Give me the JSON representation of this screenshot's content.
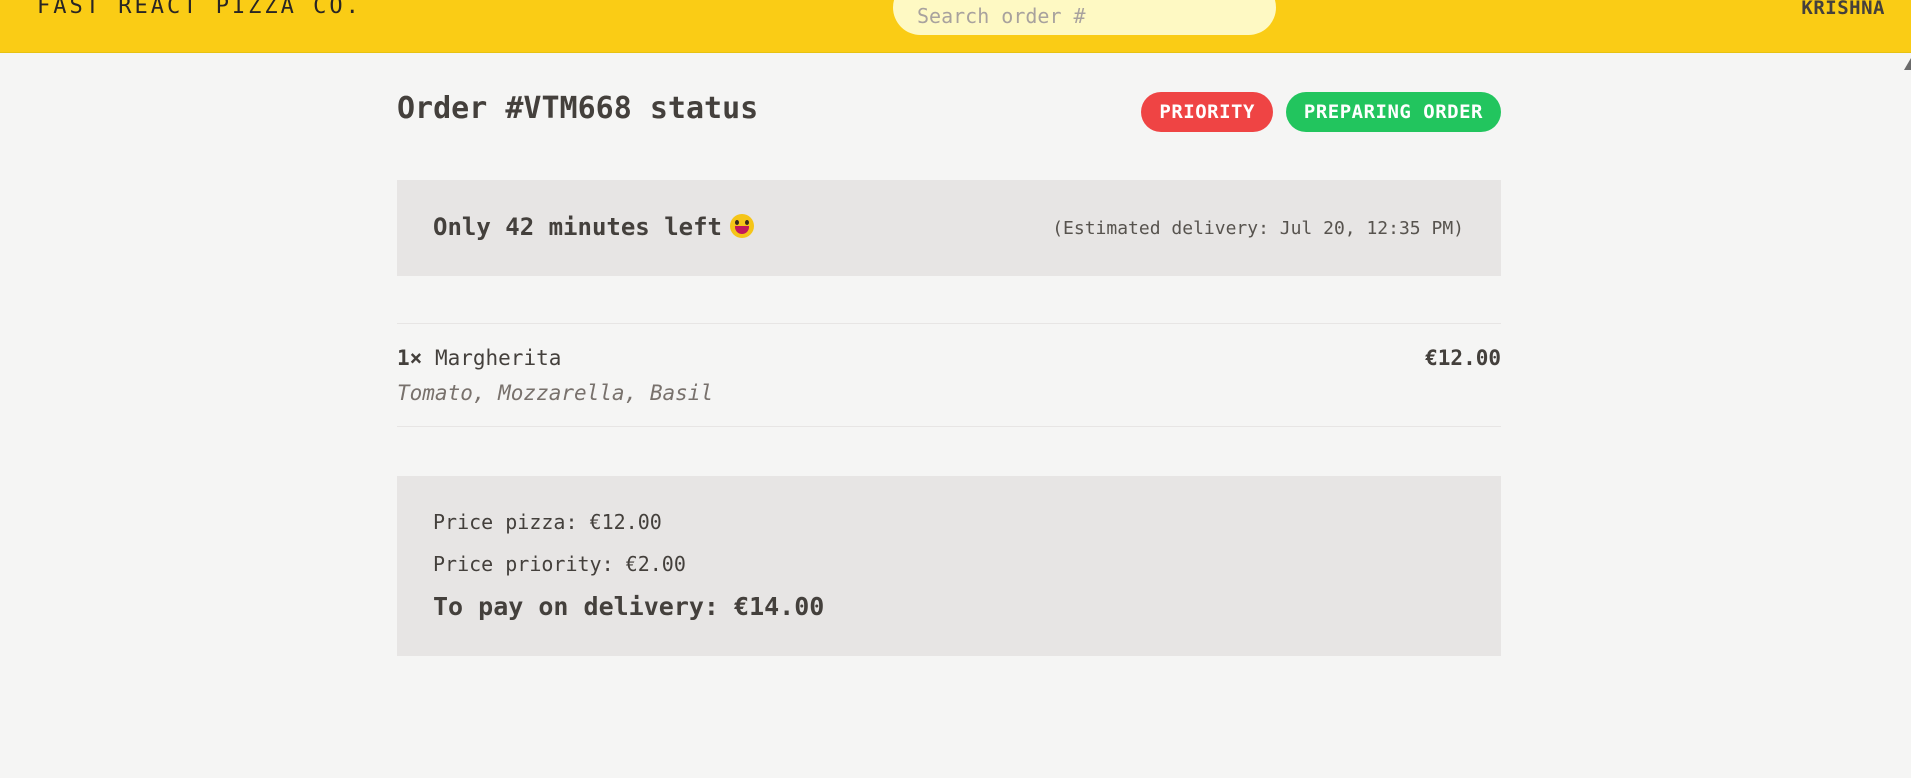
{
  "header": {
    "logo": "FAST REACT PIZZA CO.",
    "search_placeholder": "Search order #",
    "search_value": "",
    "username": "KRISHNA"
  },
  "order": {
    "title": "Order #VTM668 status",
    "badges": {
      "priority": "PRIORITY",
      "status": "PREPARING ORDER"
    },
    "countdown": "Only 42 minutes left",
    "estimate": "(Estimated delivery: Jul 20, 12:35 PM)",
    "items": [
      {
        "quantity": "1×",
        "name": "Margherita",
        "ingredients": "Tomato, Mozzarella, Basil",
        "price": "€12.00"
      }
    ],
    "totals": {
      "pizza": "Price pizza: €12.00",
      "priority": "Price priority: €2.00",
      "to_pay": "To pay on delivery: €14.00"
    }
  },
  "colors": {
    "header_bg": "#facc15",
    "search_bg": "#fef9c3",
    "priority": "#ef4444",
    "status": "#22c55e",
    "panel": "#e7e5e4",
    "page_bg": "#f5f5f4"
  },
  "icons": {
    "countdown_emoji": "grinning-face-emoji"
  }
}
